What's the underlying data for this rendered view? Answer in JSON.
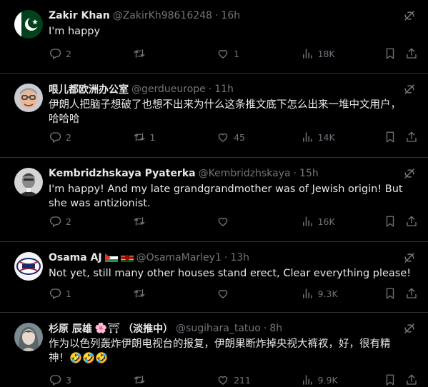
{
  "tweets": [
    {
      "name": "Zakir Khan",
      "handle": "@ZakirKh98616248",
      "time": "16h",
      "text": "I'm happy",
      "replies": "2",
      "retweets": "",
      "likes": "1",
      "views": "18K"
    },
    {
      "name": "哏儿都欧洲办公室",
      "handle": "@gerdueurope",
      "time": "11h",
      "text": "伊朗人把脑子想破了也想不出来为什么这条推文底下怎么出来一堆中文用户，哈哈哈",
      "replies": "2",
      "retweets": "1",
      "likes": "45",
      "views": "14K"
    },
    {
      "name": "Kembridzhskaya Pyaterka",
      "handle": "@Kembridzhskaya",
      "time": "15h",
      "text": "I'm happy! And my late grandgrandmother was of Jewish origin! But she was antizionist.",
      "replies": "2",
      "retweets": "",
      "likes": "",
      "views": "16K"
    },
    {
      "name": "Osama AJ",
      "handle": "@OsamaMarley1",
      "time": "13h",
      "text": "Not yet, still many other houses stand erect, Clear everything please!",
      "replies": "1",
      "retweets": "",
      "likes": "",
      "views": "9.3K"
    },
    {
      "name": "杉原 辰雄",
      "name_emoji": "🌸⛩",
      "name_suffix": "（淡推中）",
      "handle": "@sugihara_tatuo",
      "time": "8h",
      "text": "作为以色列轰炸伊朗电视台的报复，伊朗果断炸掉央视大裤衩，好，很有精神！🤣🤣🤣",
      "replies": "3",
      "retweets": "",
      "likes": "211",
      "views": "9.9K"
    }
  ],
  "separator": "·",
  "icons": [
    "grok-icon",
    "reply-icon",
    "retweet-icon",
    "like-icon",
    "views-icon",
    "bookmark-icon",
    "share-icon"
  ],
  "colors": {
    "background": "#000000",
    "text": "#e7e9ea",
    "muted": "#71767b",
    "divider": "#2f3336"
  }
}
